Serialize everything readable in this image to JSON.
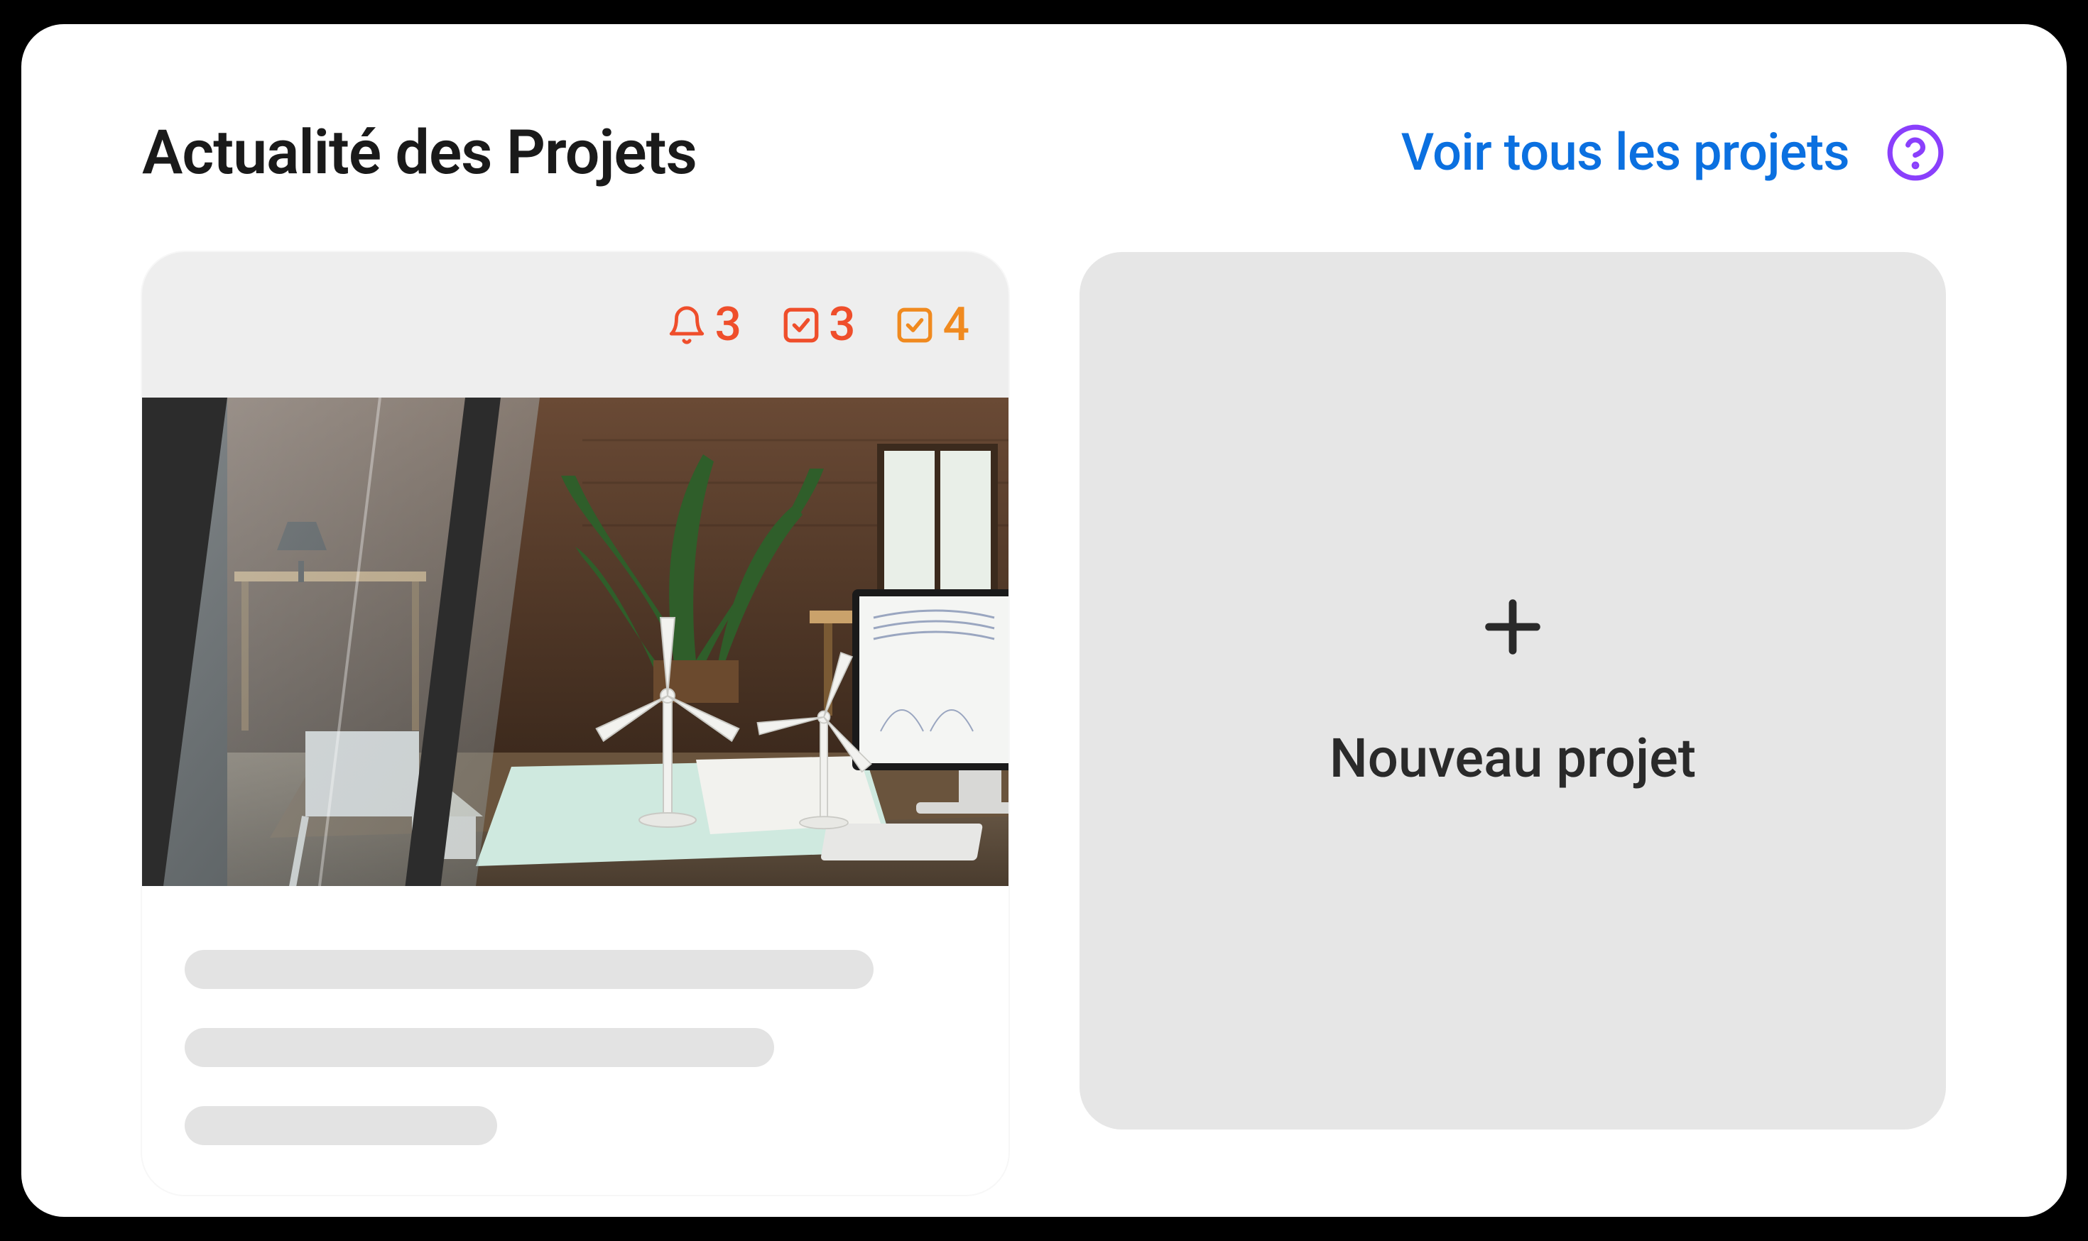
{
  "header": {
    "title": "Actualité des Projets",
    "see_all_label": "Voir tous les projets"
  },
  "project_card": {
    "stats": {
      "notifications": "3",
      "checks_red": "3",
      "checks_orange": "4"
    }
  },
  "new_project": {
    "label": "Nouveau projet"
  },
  "colors": {
    "link": "#0b70e0",
    "help_icon": "#8a3ffc",
    "stat_red": "#ef4e2b",
    "stat_orange": "#f08a1f"
  }
}
